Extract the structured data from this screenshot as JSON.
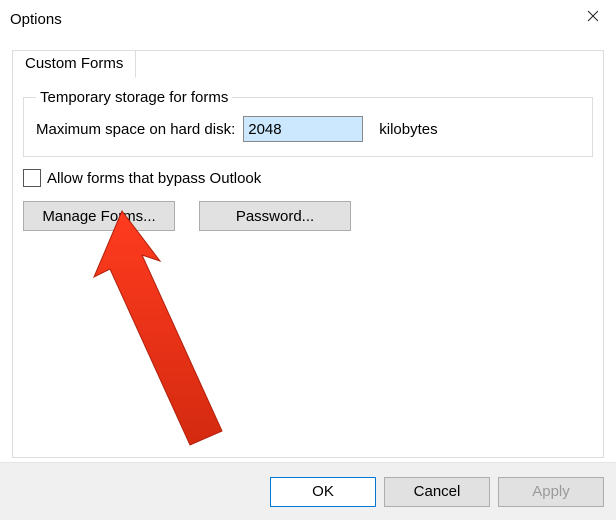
{
  "window": {
    "title": "Options"
  },
  "tab": {
    "label": "Custom Forms"
  },
  "group": {
    "legend": "Temporary storage for forms",
    "maxspace_label": "Maximum space on hard disk:",
    "maxspace_value": "2048",
    "units": "kilobytes"
  },
  "bypass": {
    "label": "Allow forms that bypass Outlook"
  },
  "buttons": {
    "manage": "Manage Forms...",
    "password": "Password..."
  },
  "footer": {
    "ok": "OK",
    "cancel": "Cancel",
    "apply": "Apply"
  },
  "annotation": {
    "color": "#ff3b1f"
  }
}
